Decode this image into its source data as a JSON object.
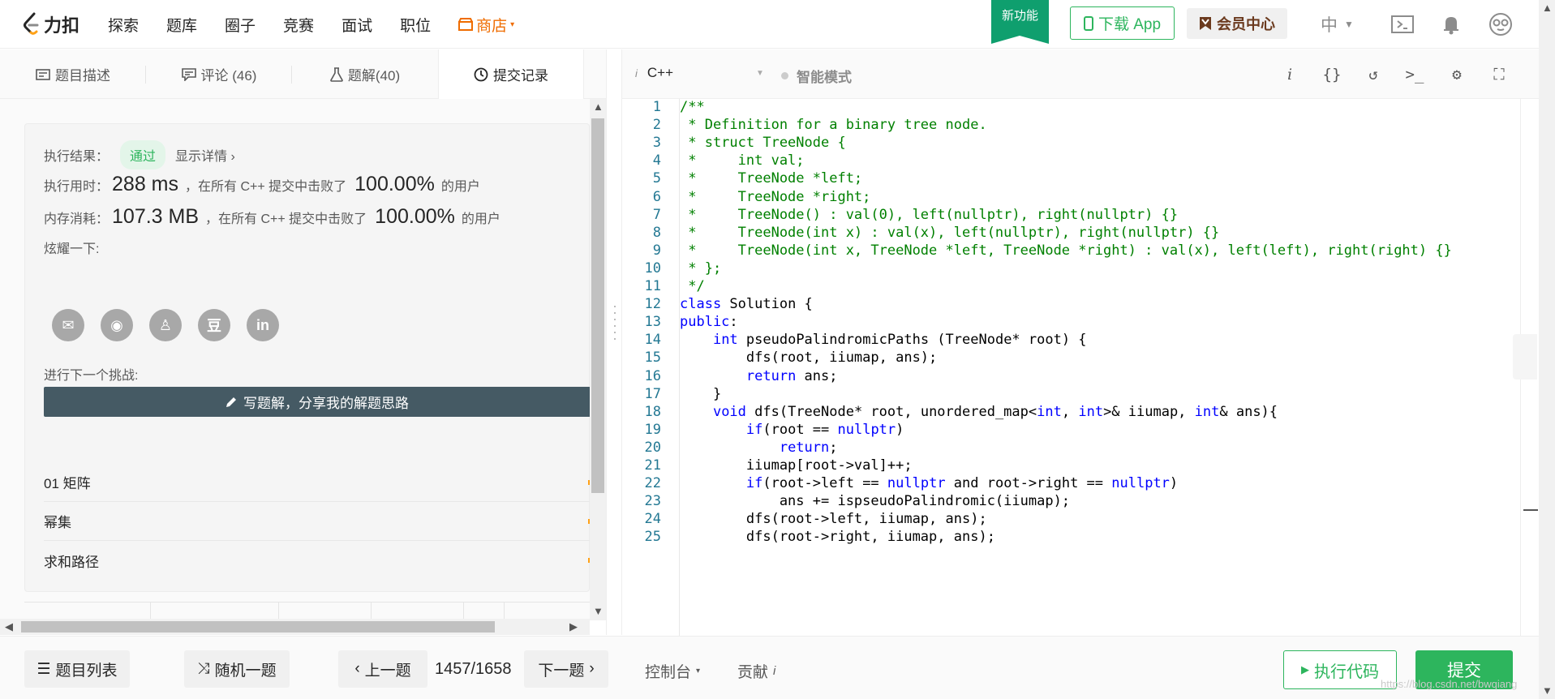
{
  "nav": {
    "logo_text": "力扣",
    "items": [
      "探索",
      "题库",
      "圈子",
      "竞赛",
      "面试",
      "职位"
    ],
    "store": "商店",
    "new_badge": "新功能",
    "download": "下载 App",
    "vip": "会员中心",
    "lang": "中"
  },
  "left_tabs": [
    {
      "label": "题目描述"
    },
    {
      "label": "评论 (46)"
    },
    {
      "label": "题解(40)"
    },
    {
      "label": "提交记录"
    }
  ],
  "result": {
    "status_label": "执行结果：",
    "status": "通过",
    "detail": "显示详情 ›",
    "time_label": "执行用时：",
    "time_value": "288 ms",
    "time_mid": "，在所有 C++ 提交中击败了",
    "time_pct": "100.00%",
    "users": "的用户",
    "mem_label": "内存消耗：",
    "mem_value": "107.3 MB",
    "mem_mid": "，在所有 C++ 提交中击败了",
    "mem_pct": "100.00%",
    "share_label": "炫耀一下:",
    "share_icons": [
      "wechat-icon",
      "weibo-icon",
      "qq-icon",
      "douban-icon",
      "linkedin-icon"
    ],
    "share_glyphs": [
      "✉",
      "◉",
      "♙",
      "豆",
      "in"
    ],
    "write_btn": "写题解，分享我的解题思路",
    "next_label": "进行下一个挑战:",
    "next_items": [
      "01 矩阵",
      "幂集",
      "求和路径"
    ]
  },
  "editor": {
    "language": "C++",
    "smart_mode": "智能模式",
    "code_lines": [
      [
        [
          "cmt",
          "/**"
        ]
      ],
      [
        [
          "cmt",
          " * Definition for a binary tree node."
        ]
      ],
      [
        [
          "cmt",
          " * struct TreeNode {"
        ]
      ],
      [
        [
          "cmt",
          " *     int val;"
        ]
      ],
      [
        [
          "cmt",
          " *     TreeNode *left;"
        ]
      ],
      [
        [
          "cmt",
          " *     TreeNode *right;"
        ]
      ],
      [
        [
          "cmt",
          " *     TreeNode() : val(0), left(nullptr), right(nullptr) {}"
        ]
      ],
      [
        [
          "cmt",
          " *     TreeNode(int x) : val(x), left(nullptr), right(nullptr) {}"
        ]
      ],
      [
        [
          "cmt",
          " *     TreeNode(int x, TreeNode *left, TreeNode *right) : val(x), left(left), right(right) {}"
        ]
      ],
      [
        [
          "cmt",
          " * };"
        ]
      ],
      [
        [
          "cmt",
          " */"
        ]
      ],
      [
        [
          "kw",
          "class"
        ],
        [
          "",
          " Solution {"
        ]
      ],
      [
        [
          "kw",
          "public"
        ],
        [
          "",
          ":"
        ]
      ],
      [
        [
          "",
          "    "
        ],
        [
          "kw",
          "int"
        ],
        [
          "",
          " pseudoPalindromicPaths (TreeNode* root) {"
        ]
      ],
      [
        [
          "",
          "        dfs(root, iiumap, ans);"
        ]
      ],
      [
        [
          "",
          "        "
        ],
        [
          "kw",
          "return"
        ],
        [
          "",
          " ans;"
        ]
      ],
      [
        [
          "",
          "    }"
        ]
      ],
      [
        [
          "",
          "    "
        ],
        [
          "kw",
          "void"
        ],
        [
          "",
          " dfs(TreeNode* root, unordered_map<"
        ],
        [
          "kw",
          "int"
        ],
        [
          "",
          ", "
        ],
        [
          "kw",
          "int"
        ],
        [
          "",
          ">& iiumap, "
        ],
        [
          "kw",
          "int"
        ],
        [
          "",
          "& ans){"
        ]
      ],
      [
        [
          "",
          "        "
        ],
        [
          "kw",
          "if"
        ],
        [
          "",
          "(root == "
        ],
        [
          "kw",
          "nullptr"
        ],
        [
          "",
          ")"
        ]
      ],
      [
        [
          "",
          "            "
        ],
        [
          "kw",
          "return"
        ],
        [
          "",
          ";"
        ]
      ],
      [
        [
          "",
          "        iiumap[root->val]++;"
        ]
      ],
      [
        [
          "",
          "        "
        ],
        [
          "kw",
          "if"
        ],
        [
          "",
          "(root->left == "
        ],
        [
          "kw",
          "nullptr"
        ],
        [
          "",
          " and root->right == "
        ],
        [
          "kw",
          "nullptr"
        ],
        [
          "",
          ")"
        ]
      ],
      [
        [
          "",
          "            ans += ispseudoPalindromic(iiumap);"
        ]
      ],
      [
        [
          "",
          "        dfs(root->left, iiumap, ans);"
        ]
      ],
      [
        [
          "",
          "        dfs(root->right, iiumap, ans);"
        ]
      ]
    ]
  },
  "bottom": {
    "problem_list": "题目列表",
    "random": "随机一题",
    "prev": "上一题",
    "counter": "1457/1658",
    "next": "下一题",
    "console": "控制台",
    "contribute": "贡献",
    "run": "执行代码",
    "submit": "提交",
    "watermark": "https://blog.csdn.net/bwqiang"
  },
  "colors": {
    "accent": "#2db55d",
    "store": "#ef6c00",
    "badge": "#0f9f6e",
    "dark_btn": "#455a64"
  }
}
